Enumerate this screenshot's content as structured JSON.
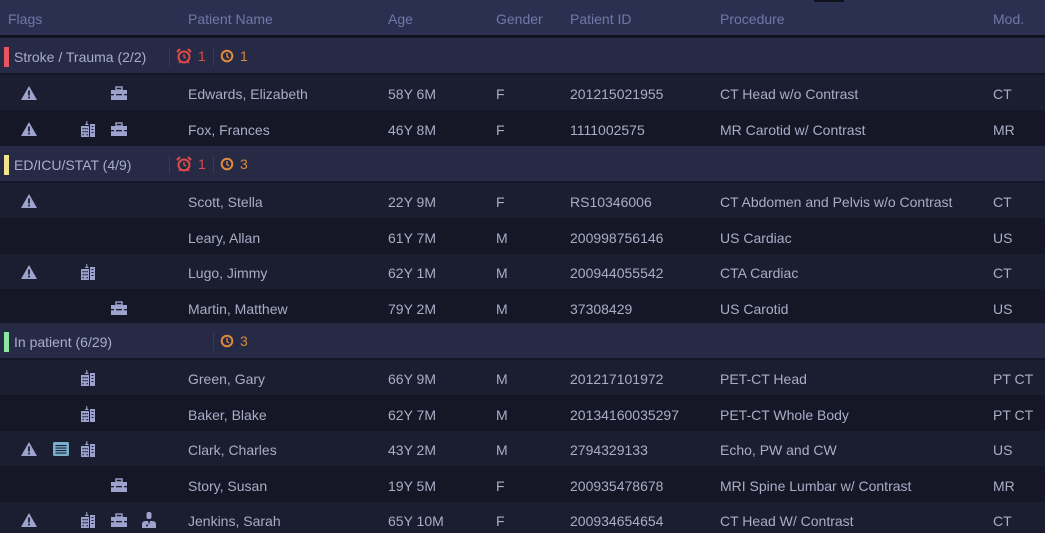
{
  "columns": {
    "flags": "Flags",
    "patient_name": "Patient Name",
    "age": "Age",
    "gender": "Gender",
    "patient_id": "Patient ID",
    "procedure": "Procedure",
    "modality": "Mod."
  },
  "colors": {
    "stroke_trauma": "#e8555e",
    "ed_icu_stat": "#f2e48a",
    "in_patient": "#8de6a4",
    "alarm": "#e24a4a",
    "timer": "#e0883c",
    "icon": "#9da3cc",
    "notes_icon": "#7aaecb"
  },
  "groups": [
    {
      "label": "Stroke / Trauma (2/2)",
      "alarm_count": "1",
      "timer_count": "1",
      "rows": [
        {
          "flags": [
            "warning",
            "briefcase"
          ],
          "name": "Edwards, Elizabeth",
          "age": "58Y 6M",
          "gender": "F",
          "id": "201215021955",
          "procedure": "CT Head w/o Contrast",
          "mod": "CT"
        },
        {
          "flags": [
            "warning",
            "building",
            "briefcase"
          ],
          "name": "Fox, Frances",
          "age": "46Y 8M",
          "gender": "F",
          "id": "1111002575",
          "procedure": "MR Carotid w/ Contrast",
          "mod": "MR"
        }
      ]
    },
    {
      "label": "ED/ICU/STAT (4/9)",
      "alarm_count": "1",
      "timer_count": "3",
      "rows": [
        {
          "flags": [
            "warning"
          ],
          "name": "Scott, Stella",
          "age": "22Y 9M",
          "gender": "F",
          "id": "RS10346006",
          "procedure": "CT Abdomen and Pelvis w/o Contrast",
          "mod": "CT"
        },
        {
          "flags": [],
          "name": "Leary, Allan",
          "age": "61Y 7M",
          "gender": "M",
          "id": "200998756146",
          "procedure": "US Cardiac",
          "mod": "US"
        },
        {
          "flags": [
            "warning",
            "building"
          ],
          "name": "Lugo, Jimmy",
          "age": "62Y 1M",
          "gender": "M",
          "id": "200944055542",
          "procedure": "CTA Cardiac",
          "mod": "CT"
        },
        {
          "flags": [
            "briefcase"
          ],
          "name": "Martin, Matthew",
          "age": "79Y 2M",
          "gender": "M",
          "id": "37308429",
          "procedure": "US Carotid",
          "mod": "US"
        }
      ]
    },
    {
      "label": "In patient (6/29)",
      "timer_count": "3",
      "rows": [
        {
          "flags": [
            "building"
          ],
          "name": "Green, Gary",
          "age": "66Y 9M",
          "gender": "M",
          "id": "201217101972",
          "procedure": "PET-CT Head",
          "mod": "PT CT"
        },
        {
          "flags": [
            "building"
          ],
          "name": "Baker, Blake",
          "age": "62Y 7M",
          "gender": "M",
          "id": "20134160035297",
          "procedure": "PET-CT Whole Body",
          "mod": "PT CT"
        },
        {
          "flags": [
            "warning",
            "notes",
            "building"
          ],
          "name": "Clark, Charles",
          "age": "43Y 2M",
          "gender": "M",
          "id": "2794329133",
          "procedure": "Echo, PW and CW",
          "mod": "US"
        },
        {
          "flags": [
            "briefcase"
          ],
          "name": "Story, Susan",
          "age": "19Y 5M",
          "gender": "F",
          "id": "200935478678",
          "procedure": "MRI Spine Lumbar w/ Contrast",
          "mod": "MR"
        },
        {
          "flags": [
            "warning",
            "building",
            "briefcase",
            "doctor"
          ],
          "name": "Jenkins, Sarah",
          "age": "65Y 10M",
          "gender": "F",
          "id": "200934654654",
          "procedure": "CT Head W/ Contrast",
          "mod": "CT"
        }
      ]
    }
  ]
}
